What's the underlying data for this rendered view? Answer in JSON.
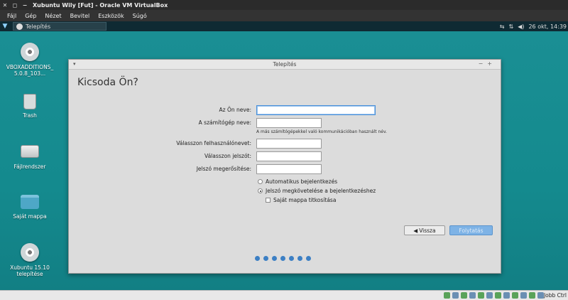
{
  "host_window": {
    "title": "Xubuntu Wily [Fut] - Oracle VM VirtualBox",
    "menu": [
      "Fájl",
      "Gép",
      "Nézet",
      "Bevitel",
      "Eszközök",
      "Súgó"
    ],
    "host_key": "Jobb Ctrl"
  },
  "panel": {
    "task_label": "Telepítés",
    "clock": "26 okt, 14:39"
  },
  "desktop_icons": [
    {
      "label": "VBOXADDITIONS_5.0.8_103...",
      "icon": "cd-icon"
    },
    {
      "label": "Trash",
      "icon": "trash-icon"
    },
    {
      "label": "Fájlrendszer",
      "icon": "drive-icon"
    },
    {
      "label": "Saját mappa",
      "icon": "home-folder-icon"
    },
    {
      "label": "Xubuntu 15.10 telepítése",
      "icon": "installer-cd-icon"
    }
  ],
  "dialog": {
    "window_title": "Telepítés",
    "heading": "Kicsoda Ön?",
    "fields": {
      "name_label": "Az Ön neve:",
      "name_value": "",
      "computer_label": "A számítógép neve:",
      "computer_value": "",
      "computer_hint": "A más számítógépekkel való kommunikációban használt név.",
      "username_label": "Válasszon felhasználónevet:",
      "username_value": "",
      "password_label": "Válasszon jelszót:",
      "password_value": "",
      "confirm_label": "Jelszó megerősítése:",
      "confirm_value": ""
    },
    "options": {
      "auto_login": "Automatikus bejelentkezés",
      "require_password": "Jelszó megkövetelése a bejelentkezéshez",
      "encrypt_home": "Saját mappa titkosítása",
      "selected": "require_password"
    },
    "buttons": {
      "back": "Vissza",
      "next": "Folytatás"
    },
    "progress": {
      "steps": 7,
      "colour": "#3c7fc4"
    }
  }
}
